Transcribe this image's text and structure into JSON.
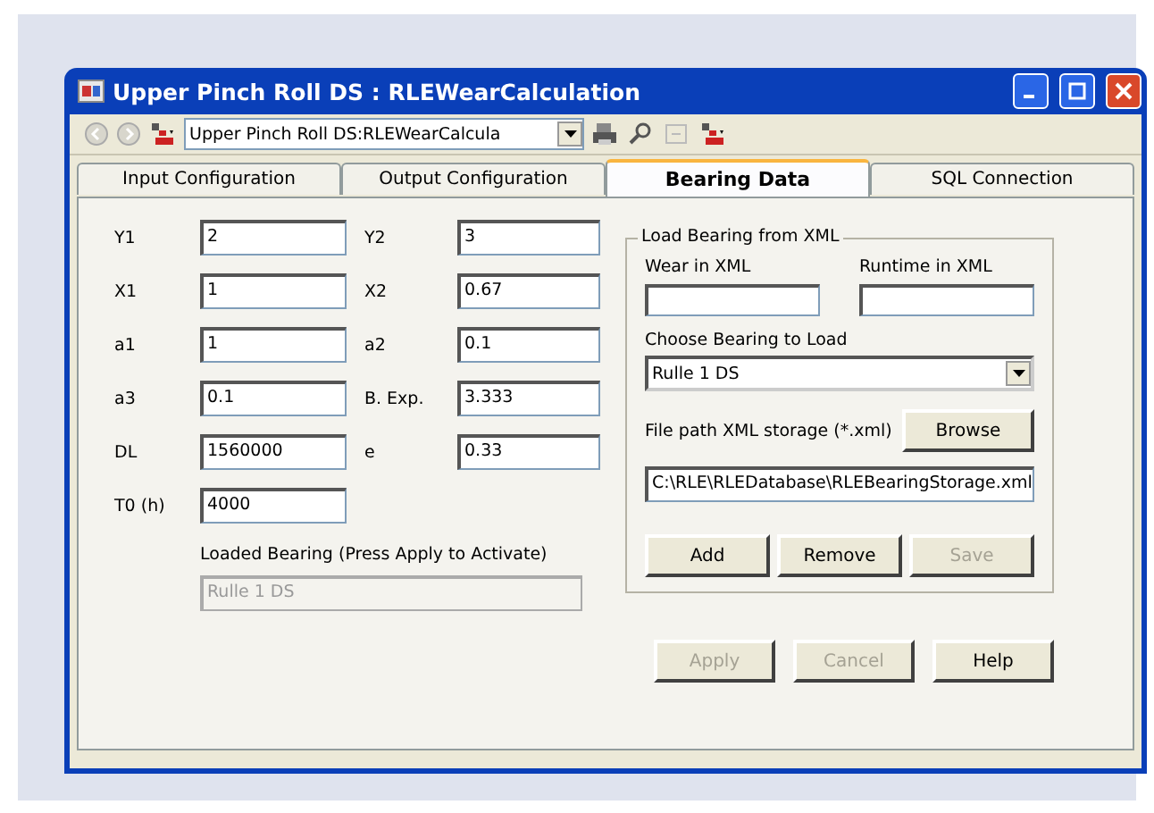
{
  "window": {
    "title": "Upper Pinch Roll DS : RLEWearCalculation"
  },
  "toolbar": {
    "back_disabled": true,
    "forward_disabled": true,
    "dropdown_value": "Upper Pinch Roll DS:RLEWearCalcula"
  },
  "tabs": [
    {
      "label": "Input Configuration",
      "selected": false
    },
    {
      "label": "Output Configuration",
      "selected": false
    },
    {
      "label": "Bearing Data",
      "selected": true
    },
    {
      "label": "SQL Connection",
      "selected": false
    }
  ],
  "parameters": [
    {
      "label": "Y1",
      "value": "2"
    },
    {
      "label": "Y2",
      "value": "3"
    },
    {
      "label": "X1",
      "value": "1"
    },
    {
      "label": "X2",
      "value": "0.67"
    },
    {
      "label": "a1",
      "value": "1"
    },
    {
      "label": "a2",
      "value": "0.1"
    },
    {
      "label": "a3",
      "value": "0.1"
    },
    {
      "label": "B. Exp.",
      "value": "3.333"
    },
    {
      "label": "DL",
      "value": "1560000"
    },
    {
      "label": "e",
      "value": "0.33"
    },
    {
      "label": "T0 (h)",
      "value": "4000"
    }
  ],
  "loaded_bearing": {
    "label": "Loaded Bearing (Press Apply to Activate)",
    "value": "Rulle 1 DS",
    "disabled": true
  },
  "xml_group": {
    "title": "Load Bearing from XML",
    "wear_label": "Wear in XML",
    "runtime_label": "Runtime in XML",
    "choose_label": "Choose Bearing to Load",
    "choose_value": "Rulle 1 DS",
    "path_label": "File path XML storage  (*.xml)",
    "browse": "Browse",
    "path_value": "C:\\RLE\\RLEDatabase\\RLEBearingStorage.xml",
    "buttons": [
      {
        "label": "Add",
        "disabled": false
      },
      {
        "label": "Remove",
        "disabled": false
      },
      {
        "label": "Save",
        "disabled": true
      }
    ]
  },
  "buttons": [
    {
      "label": "Apply",
      "disabled": true
    },
    {
      "label": "Cancel",
      "disabled": true
    },
    {
      "label": "Help",
      "disabled": false
    }
  ]
}
